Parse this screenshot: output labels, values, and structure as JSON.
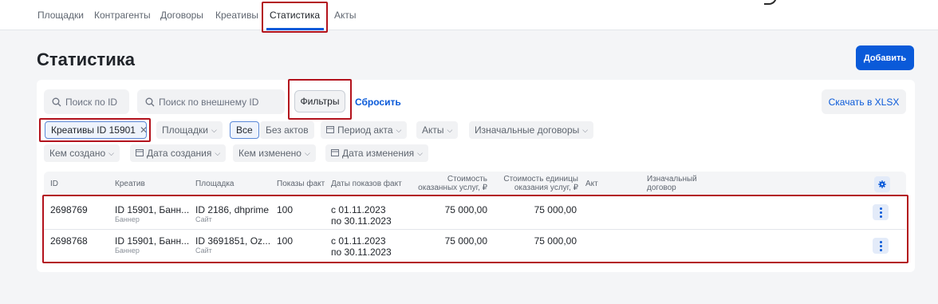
{
  "nav": {
    "tabs": [
      {
        "label": "Площадки"
      },
      {
        "label": "Контрагенты"
      },
      {
        "label": "Договоры"
      },
      {
        "label": "Креативы"
      },
      {
        "label": "Статистика",
        "active": true
      },
      {
        "label": "Акты"
      }
    ]
  },
  "page": {
    "title": "Статистика",
    "add_button": "Добавить"
  },
  "search": {
    "by_id_placeholder": "Поиск по ID",
    "by_external_id_placeholder": "Поиск по внешнему ID"
  },
  "toolbar": {
    "filters_button": "Фильтры",
    "reset_link": "Сбросить",
    "export_button": "Скачать в XLSX"
  },
  "filters": {
    "active_chip": "Креативы ID 15901",
    "platforms": "Площадки",
    "all": "Все",
    "without_acts": "Без актов",
    "act_period": "Период акта",
    "acts": "Акты",
    "original_contracts": "Изначальные договоры",
    "created_by": "Кем создано",
    "created_date": "Дата создания",
    "modified_by": "Кем изменено",
    "modified_date": "Дата изменения"
  },
  "table": {
    "columns": {
      "id": "ID",
      "creative": "Креатив",
      "platform": "Площадка",
      "impressions": "Показы факт",
      "dates": "Даты показов факт",
      "cost_line1": "Стоимость",
      "cost_line2": "оказанных услуг, ₽",
      "unit_cost_line1": "Стоимость единицы",
      "unit_cost_line2": "оказания услуг, ₽",
      "act": "Акт",
      "contract_line1": "Изначальный",
      "contract_line2": "договор"
    },
    "rows": [
      {
        "id": "2698769",
        "creative": "ID 15901, Банн...",
        "creative_type": "Баннер",
        "platform": "ID 2186, dhprime",
        "platform_type": "Сайт",
        "impressions": "100",
        "date_from": "с 01.11.2023",
        "date_to": "по 30.11.2023",
        "cost": "75 000,00",
        "unit_cost": "75 000,00"
      },
      {
        "id": "2698768",
        "creative": "ID 15901, Банн...",
        "creative_type": "Баннер",
        "platform": "ID 3691851, Oz...",
        "platform_type": "Сайт",
        "impressions": "100",
        "date_from": "с 01.11.2023",
        "date_to": "по 30.11.2023",
        "cost": "75 000,00",
        "unit_cost": "75 000,00"
      }
    ]
  },
  "colors": {
    "accent": "#0a5ad9",
    "highlight": "#b3121c",
    "background": "#f4f5f7"
  }
}
